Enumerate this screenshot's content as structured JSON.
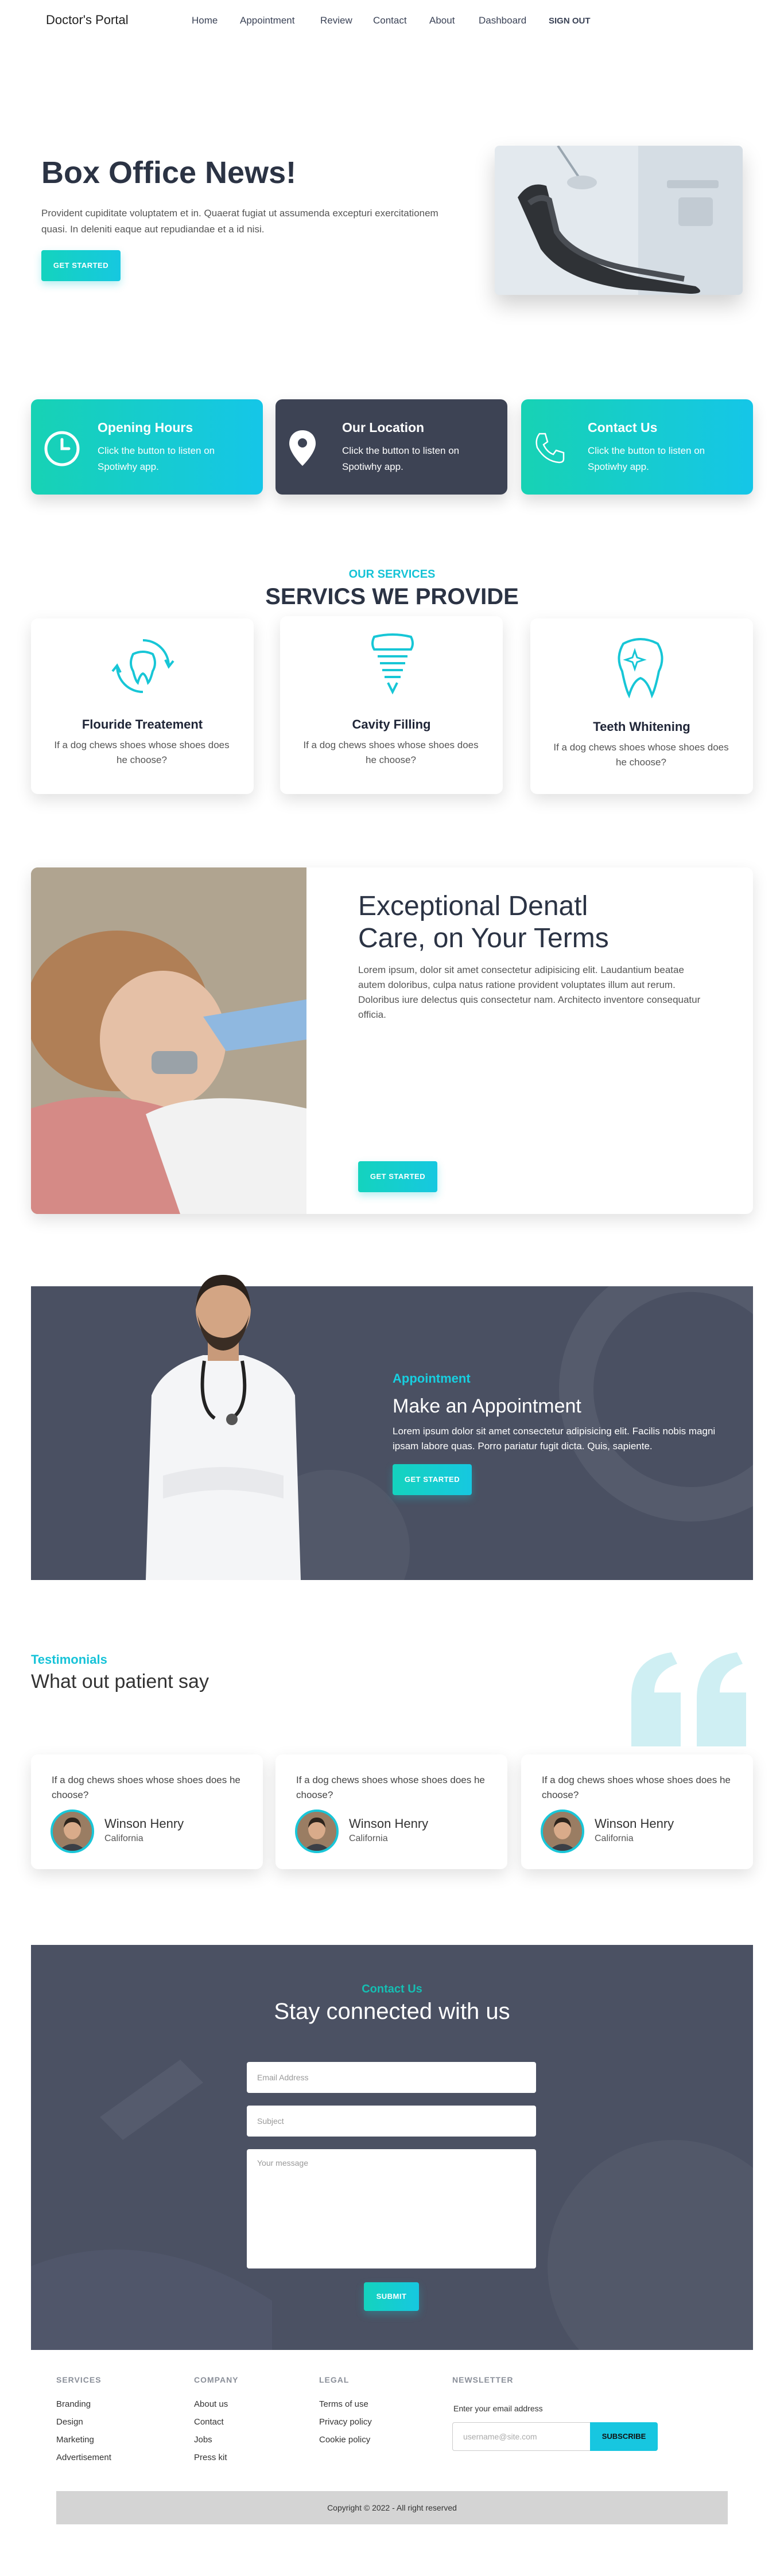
{
  "nav": {
    "brand": "Doctor's Portal",
    "links": [
      "Home",
      "Appointment",
      "Review",
      "Contact",
      "About",
      "Dashboard"
    ],
    "signout": "SIGN OUT"
  },
  "hero": {
    "title": "Box Office News!",
    "text": "Provident cupiditate voluptatem et in. Quaerat fugiat ut assumenda excepturi exercitationem quasi. In deleniti eaque aut repudiandae et a id nisi.",
    "button": "GET STARTED"
  },
  "info_cards": [
    {
      "title": "Opening Hours",
      "text": "Click the button to listen on Spotiwhy app.",
      "icon": "clock-icon"
    },
    {
      "title": "Our Location",
      "text": "Click the button to listen on Spotiwhy app.",
      "icon": "location-pin-icon"
    },
    {
      "title": "Contact Us",
      "text": "Click the button to listen on Spotiwhy app.",
      "icon": "phone-icon"
    }
  ],
  "services": {
    "kicker": "OUR SERVICES",
    "title": "SERVICS WE PROVIDE",
    "items": [
      {
        "title": "Flouride Treatement",
        "text": "If a dog chews shoes whose shoes does he choose?",
        "icon": "tooth-refresh-icon"
      },
      {
        "title": "Cavity Filling",
        "text": "If a dog chews shoes whose shoes does he choose?",
        "icon": "tooth-implant-icon"
      },
      {
        "title": "Teeth Whitening",
        "text": "If a dog chews shoes whose shoes does he choose?",
        "icon": "tooth-sparkle-icon"
      }
    ]
  },
  "care": {
    "title_line1": "Exceptional Denatl",
    "title_line2": "Care, on Your Terms",
    "text": "Lorem ipsum, dolor sit amet consectetur adipisicing elit. Laudantium beatae autem doloribus, culpa natus ratione provident voluptates illum aut rerum. Doloribus iure delectus quis consectetur nam. Architecto inventore consequatur officia.",
    "button": "GET STARTED"
  },
  "appointment": {
    "kicker": "Appointment",
    "title": "Make an Appointment",
    "text": "Lorem ipsum dolor sit amet consectetur adipisicing elit. Facilis nobis magni ipsam labore quas. Porro pariatur fugit dicta. Quis, sapiente.",
    "button": "GET STARTED"
  },
  "testimonials": {
    "kicker": "Testimonials",
    "title": "What out patient say",
    "items": [
      {
        "quote": "If a dog chews shoes whose shoes does he choose?",
        "name": "Winson Henry",
        "location": "California"
      },
      {
        "quote": "If a dog chews shoes whose shoes does he choose?",
        "name": "Winson Henry",
        "location": "California"
      },
      {
        "quote": "If a dog chews shoes whose shoes does he choose?",
        "name": "Winson Henry",
        "location": "California"
      }
    ]
  },
  "contact": {
    "kicker": "Contact Us",
    "title": "Stay connected with us",
    "email_placeholder": "Email Address",
    "subject_placeholder": "Subject",
    "message_placeholder": "Your message",
    "button": "SUBMIT"
  },
  "footer": {
    "services": {
      "head": "SERVICES",
      "links": [
        "Branding",
        "Design",
        "Marketing",
        "Advertisement"
      ]
    },
    "company": {
      "head": "COMPANY",
      "links": [
        "About us",
        "Contact",
        "Jobs",
        "Press kit"
      ]
    },
    "legal": {
      "head": "LEGAL",
      "links": [
        "Terms of use",
        "Privacy policy",
        "Cookie policy"
      ]
    },
    "newsletter": {
      "head": "NEWSLETTER",
      "label": "Enter your email address",
      "placeholder": "username@site.com",
      "button": "SUBSCRIBE"
    },
    "copyright": "Copyright © 2022 - All right reserved"
  },
  "colors": {
    "accent": "#14cdc8",
    "dark": "#3d4354"
  }
}
